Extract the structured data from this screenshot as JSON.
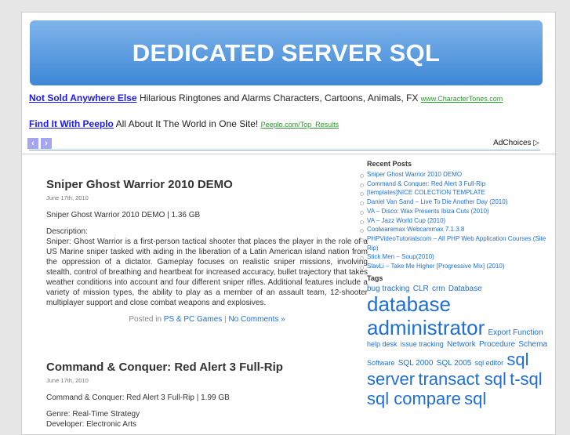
{
  "header": {
    "title": "DEDICATED SERVER SQL"
  },
  "ads": [
    {
      "title": "Not Sold Anywhere Else",
      "text": "Hilarious Ringtones and Alarms Characters, Cartoons, Animals, FX",
      "url": "www.CharacterTones.com"
    },
    {
      "title": "Find It With Peeplo",
      "text": "All About It The World in One Site!",
      "url": "Peeplo.com/Top_Results"
    }
  ],
  "ad_nav": {
    "prev": "‹",
    "next": "›",
    "adchoices": "AdChoices ▷"
  },
  "posts": [
    {
      "title": "Sniper Ghost Warrior 2010 DEMO",
      "date": "June 17th, 2010",
      "summary": "Sniper Ghost Warrior 2010 DEMO | 1.36 GB",
      "desc_label": "Description:",
      "desc": "Sniper: Ghost Warrior is a first-person tactical shooter that places the player in the role of a US Marine sniper tasked with aiding in the liberation of a Latin American island nation from the oppression of a dictator. Gameplay focuses on realistic sniper missions, involving stealth, control of breathing and heartbeat for increased accuracy, bullet trajectory that takes weather conditions into account and four different sniper rifles. Additional features include a variety of mission types, the ability to play as a member of an assault team, 12-shooter multiplayer support and close combat weapons and explosives.",
      "posted_in": "Posted in",
      "category": "PS & PC Games",
      "sep": "|",
      "comments": "No Comments »"
    },
    {
      "title": "Command & Conquer: Red Alert 3 Full-Rip",
      "date": "June 17th, 2010",
      "summary": "Command & Conquer: Red Alert 3 Full-Rip | 1.99 GB",
      "genre": "Genre: Real-Time Strategy",
      "developer": "Developer: Electronic Arts"
    }
  ],
  "sidebar": {
    "recent_title": "Recent Posts",
    "recent": [
      "Sniper Ghost Warrior 2010 DEMO",
      "Command & Conquer: Red Alert 3 Full-Rip",
      "[templates]NICE COLECTION TEMPLATE",
      "Daniel Van Sand – Live To Die Another Day (2010)",
      "VA – Disco: Wax Presents Ibiza Cuts (2010)",
      "VA – Jazz World Cup (2010)",
      "Coolwaremax Webcammax 7.1.3.8",
      "PHPVideoTutorialscom – All PHP Web Application Courses (Site Rip)",
      "Stick Men – Soup(2010)",
      "SlavLi – Take Me Higher [Progressive Mix] (2010)"
    ],
    "tags_title": "Tags",
    "tags": [
      {
        "t": "bug tracking",
        "s": 10
      },
      {
        "t": "CLR",
        "s": 10
      },
      {
        "t": "crm",
        "s": 10
      },
      {
        "t": "Database",
        "s": 10
      },
      {
        "t": "database administrator",
        "s": 26
      },
      {
        "t": "Export Function",
        "s": 10
      },
      {
        "t": "help desk",
        "s": 9
      },
      {
        "t": "issue tracking",
        "s": 9
      },
      {
        "t": "Network",
        "s": 10
      },
      {
        "t": "Procedure",
        "s": 10
      },
      {
        "t": "Schema",
        "s": 10
      },
      {
        "t": "Software",
        "s": 9
      },
      {
        "t": "SQL 2000",
        "s": 10
      },
      {
        "t": "SQL 2005",
        "s": 10
      },
      {
        "t": "sql editor",
        "s": 9
      },
      {
        "t": "sql server",
        "s": 22
      },
      {
        "t": "transact sql",
        "s": 22
      },
      {
        "t": "t-sql",
        "s": 22
      },
      {
        "t": "sql compare",
        "s": 22
      },
      {
        "t": "sql",
        "s": 22
      }
    ]
  }
}
